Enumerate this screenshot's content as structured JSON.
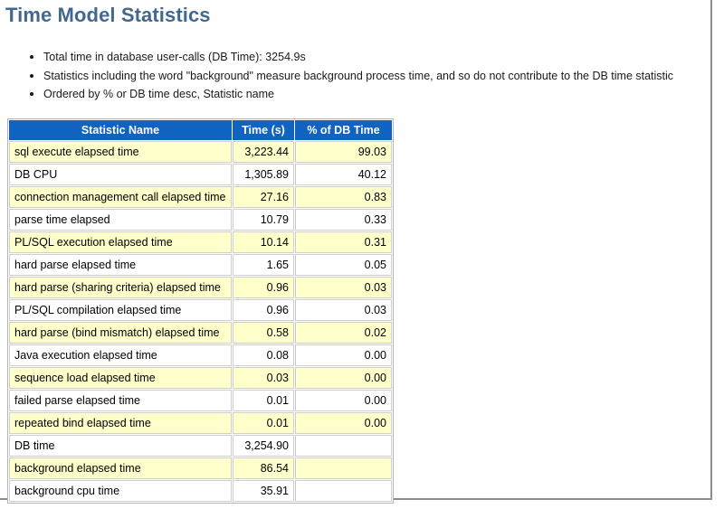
{
  "page": {
    "title": "Time Model Statistics",
    "notes": [
      "Total time in database user-calls (DB Time): 3254.9s",
      "Statistics including the word \"background\" measure background process time, and so do not contribute to the DB time statistic",
      "Ordered by % or DB time desc, Statistic name"
    ]
  },
  "colors": {
    "title": "#43688f",
    "header_bg": "#1063c1",
    "header_text": "#ffffff",
    "row_odd_bg": "#ffffcc",
    "row_even_bg": "#ffffff",
    "frame_border": "#8c8c8c"
  },
  "table": {
    "columns": [
      "Statistic Name",
      "Time (s)",
      "% of DB Time"
    ],
    "rows": [
      {
        "name": "sql execute elapsed time",
        "time": "3,223.44",
        "pct": "99.03"
      },
      {
        "name": "DB CPU",
        "time": "1,305.89",
        "pct": "40.12"
      },
      {
        "name": "connection management call elapsed time",
        "time": "27.16",
        "pct": "0.83"
      },
      {
        "name": "parse time elapsed",
        "time": "10.79",
        "pct": "0.33"
      },
      {
        "name": "PL/SQL execution elapsed time",
        "time": "10.14",
        "pct": "0.31"
      },
      {
        "name": "hard parse elapsed time",
        "time": "1.65",
        "pct": "0.05"
      },
      {
        "name": "hard parse (sharing criteria) elapsed time",
        "time": "0.96",
        "pct": "0.03"
      },
      {
        "name": "PL/SQL compilation elapsed time",
        "time": "0.96",
        "pct": "0.03"
      },
      {
        "name": "hard parse (bind mismatch) elapsed time",
        "time": "0.58",
        "pct": "0.02"
      },
      {
        "name": "Java execution elapsed time",
        "time": "0.08",
        "pct": "0.00"
      },
      {
        "name": "sequence load elapsed time",
        "time": "0.03",
        "pct": "0.00"
      },
      {
        "name": "failed parse elapsed time",
        "time": "0.01",
        "pct": "0.00"
      },
      {
        "name": "repeated bind elapsed time",
        "time": "0.01",
        "pct": "0.00"
      },
      {
        "name": "DB time",
        "time": "3,254.90",
        "pct": ""
      },
      {
        "name": "background elapsed time",
        "time": "86.54",
        "pct": ""
      },
      {
        "name": "background cpu time",
        "time": "35.91",
        "pct": ""
      }
    ]
  }
}
